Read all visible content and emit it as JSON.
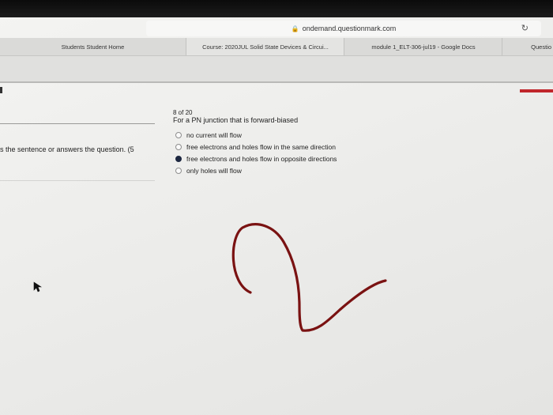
{
  "browser": {
    "url": "ondemand.questionmark.com",
    "lock_icon": "lock-icon",
    "reload_icon": "reload-icon"
  },
  "tabs": [
    {
      "label": "Students Student Home"
    },
    {
      "label": "Course: 2020JUL Solid State Devices & Circui..."
    },
    {
      "label": "module 1_ELT-306-jul19 - Google Docs"
    },
    {
      "label": "Questio"
    }
  ],
  "left_panel": {
    "instructions": "s the sentence or answers the question. (5"
  },
  "quiz": {
    "counter": "8 of 20",
    "question": "For a PN junction that is forward-biased",
    "options": [
      {
        "label": "no current will flow",
        "selected": false
      },
      {
        "label": "free electrons and holes flow in the same direction",
        "selected": false
      },
      {
        "label": "free electrons and holes flow in opposite directions",
        "selected": true
      },
      {
        "label": "only holes will flow",
        "selected": false
      }
    ]
  },
  "colors": {
    "accent_red": "#c0262b",
    "selected_radio": "#1d2740",
    "scribble": "#7a1212"
  }
}
